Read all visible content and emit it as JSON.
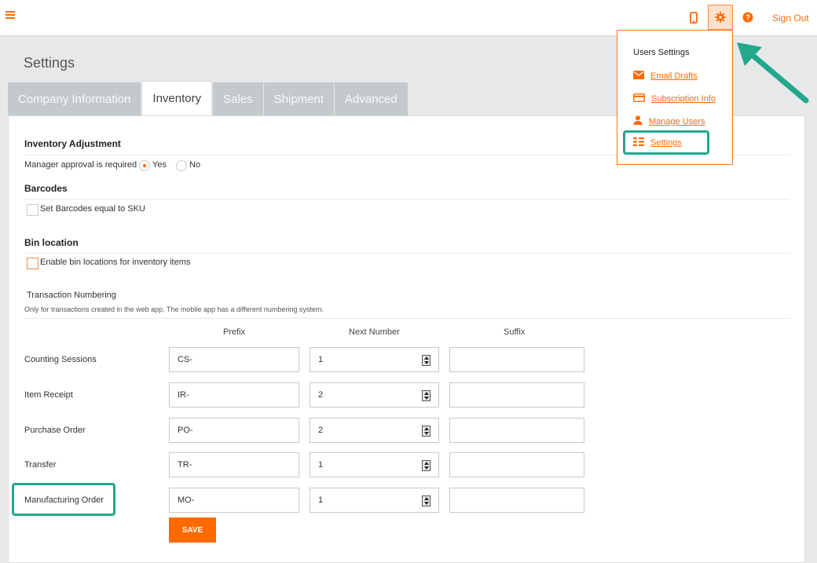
{
  "header": {
    "signout_label": "Sign Out",
    "icons": [
      "menu-icon",
      "mobile-icon",
      "gear-icon",
      "help-icon"
    ]
  },
  "page": {
    "title": "Settings"
  },
  "tabs": [
    {
      "label": "Company Information"
    },
    {
      "label": "Inventory"
    },
    {
      "label": "Sales"
    },
    {
      "label": "Shipment"
    },
    {
      "label": "Advanced"
    }
  ],
  "inventory_adjustment": {
    "title": "Inventory Adjustment",
    "question": "Manager approval is required",
    "options": [
      {
        "label": "Yes",
        "selected": true
      },
      {
        "label": "No",
        "selected": false
      }
    ]
  },
  "barcodes": {
    "title": "Barcodes",
    "checkbox_label": "Set Barcodes equal to SKU"
  },
  "bin_location": {
    "title": "Bin location",
    "checkbox_label": "Enable bin locations for inventory items"
  },
  "numbering": {
    "title": "Transaction Numbering",
    "note": "Only for transactions created in the web app. The mobile app has a different numbering system.",
    "columns": {
      "prefix": "Prefix",
      "next": "Next Number",
      "suffix": "Suffix"
    },
    "rows": [
      {
        "label": "Counting Sessions",
        "prefix": "CS-",
        "next": "1",
        "suffix": ""
      },
      {
        "label": "Item Receipt",
        "prefix": "IR-",
        "next": "2",
        "suffix": ""
      },
      {
        "label": "Purchase Order",
        "prefix": "PO-",
        "next": "2",
        "suffix": ""
      },
      {
        "label": "Transfer",
        "prefix": "TR-",
        "next": "1",
        "suffix": ""
      },
      {
        "label": "Manufacturing Order",
        "prefix": "MO-",
        "next": "1",
        "suffix": ""
      }
    ],
    "save_label": "SAVE"
  },
  "user_menu": {
    "title": "Users Settings",
    "items": [
      {
        "label": "Email Drafts",
        "icon": "envelope-icon"
      },
      {
        "label": "Subscription Info",
        "icon": "credit-card-icon"
      },
      {
        "label": "Manage Users",
        "icon": "user-icon"
      },
      {
        "label": "Settings",
        "icon": "settings-list-icon"
      }
    ]
  },
  "colors": {
    "accent": "#ff6a00",
    "highlight": "#22a88a",
    "tab_inactive": "#c3c9cc"
  }
}
